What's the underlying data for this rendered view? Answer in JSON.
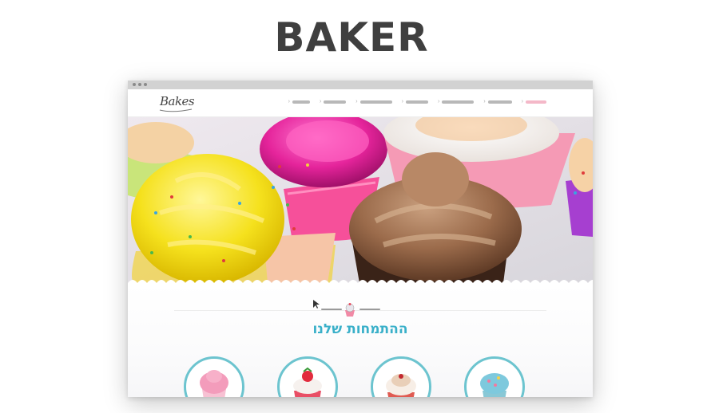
{
  "header": {
    "title": "BAKER"
  },
  "browser": {
    "logo": {
      "text": "Bakes",
      "icon": "script-logo-icon"
    },
    "nav": {
      "items": [
        {
          "icon": "nav-bullet-icon",
          "width": 22,
          "active": false
        },
        {
          "icon": "nav-bullet-icon",
          "width": 28,
          "active": false
        },
        {
          "icon": "nav-bullet-icon",
          "width": 40,
          "active": false
        },
        {
          "icon": "nav-bullet-icon",
          "width": 28,
          "active": false
        },
        {
          "icon": "nav-bullet-icon",
          "width": 40,
          "active": false
        },
        {
          "icon": "nav-bullet-icon",
          "width": 30,
          "active": false
        },
        {
          "icon": "nav-bullet-icon",
          "width": 26,
          "active": true
        }
      ]
    },
    "section": {
      "heading": "ההתמחות שלנו",
      "ornament_icon": "cupcake-ornament-icon"
    },
    "products": [
      {
        "name": "pink-swirl-cupcake",
        "frosting": "#f39cbb",
        "base": "#f7c1d3"
      },
      {
        "name": "strawberry-cupcake",
        "frosting": "#f6f1ee",
        "base": "#e94f66"
      },
      {
        "name": "red-velvet-cupcake",
        "frosting": "#f7eee6",
        "base": "#e05b52"
      },
      {
        "name": "blue-sprinkle-cupcake",
        "frosting": "#7ec9dd",
        "base": "#89c8d6"
      }
    ],
    "colors": {
      "accent": "#3ab0c9",
      "ring": "#6cc4cf",
      "nav_active": "#f4b8c8"
    }
  }
}
